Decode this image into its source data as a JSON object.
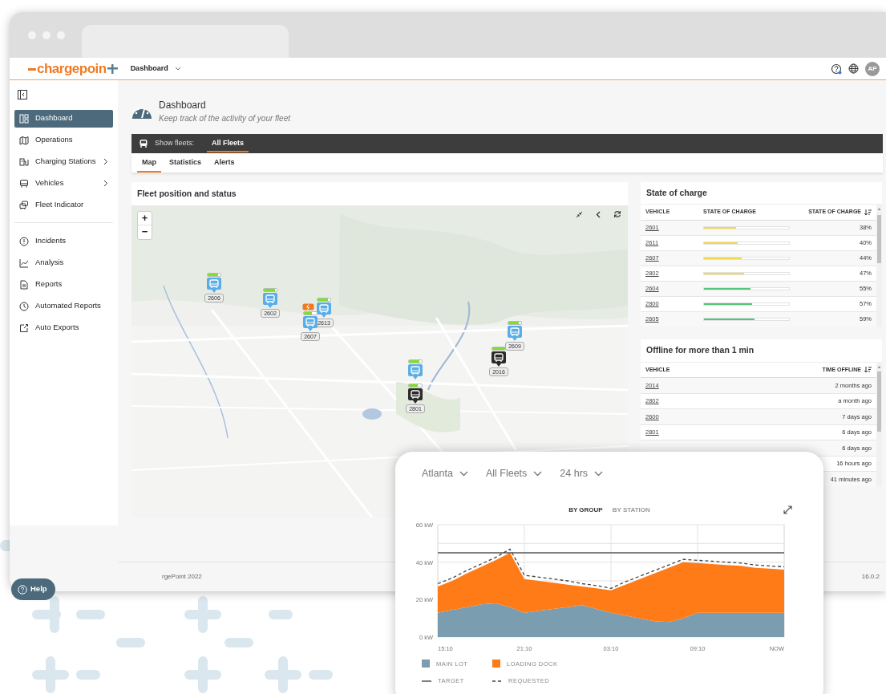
{
  "header": {
    "logo": "chargepoin",
    "menu": "Dashboard",
    "avatar": "AP"
  },
  "sidebar": {
    "groups": [
      [
        {
          "label": "Dashboard",
          "kind": "dashboard",
          "selected": true,
          "expandable": false
        },
        {
          "label": "Operations",
          "kind": "map",
          "selected": false,
          "expandable": false
        },
        {
          "label": "Charging Stations",
          "kind": "station",
          "selected": false,
          "expandable": true
        },
        {
          "label": "Vehicles",
          "kind": "bus",
          "selected": false,
          "expandable": true
        },
        {
          "label": "Fleet Indicator",
          "kind": "fleet",
          "selected": false,
          "expandable": false
        }
      ],
      [
        {
          "label": "Incidents",
          "kind": "alert",
          "selected": false,
          "expandable": false
        },
        {
          "label": "Analysis",
          "kind": "chart",
          "selected": false,
          "expandable": false
        },
        {
          "label": "Reports",
          "kind": "document",
          "selected": false,
          "expandable": false
        },
        {
          "label": "Automated Reports",
          "kind": "clock",
          "selected": false,
          "expandable": false
        },
        {
          "label": "Auto Exports",
          "kind": "export",
          "selected": false,
          "expandable": false
        }
      ]
    ]
  },
  "page": {
    "title": "Dashboard",
    "subtitle": "Keep track of the activity of your fleet"
  },
  "fleet_bar": {
    "label": "Show fleets:",
    "fleets": [
      {
        "label": "All Fleets",
        "selected": true
      }
    ]
  },
  "tabs": [
    {
      "label": "Map",
      "selected": true
    },
    {
      "label": "Statistics",
      "selected": false
    },
    {
      "label": "Alerts",
      "selected": false
    }
  ],
  "map_card": {
    "title": "Fleet position and status",
    "zoom_in": "+",
    "zoom_out": "−",
    "markers": [
      {
        "label": "2606",
        "kind": "online",
        "level": 0.8,
        "charging": false
      },
      {
        "label": "2602",
        "kind": "online",
        "level": 0.9,
        "charging": false
      },
      {
        "label": "2613",
        "kind": "online",
        "level": 0.8,
        "charging": false
      },
      {
        "label": "2607",
        "kind": "online",
        "level": 0.6,
        "charging": true
      },
      {
        "label": "2609",
        "kind": "online",
        "level": 0.8,
        "charging": false
      },
      {
        "label": "2016",
        "kind": "offline",
        "level": 1.0,
        "charging": false
      },
      {
        "kind": "online",
        "level": 0.8,
        "charging": false
      },
      {
        "label": "2801",
        "kind": "offline",
        "level": 0.7,
        "charging": false
      }
    ]
  },
  "state_of_charge": {
    "title": "State of charge",
    "columns": [
      "VEHICLE",
      "STATE OF CHARGE",
      "STATE OF CHARGE"
    ],
    "rows": [
      {
        "vehicle": "2601",
        "level": 0.38,
        "color": "#f2d94e",
        "percent": "38%"
      },
      {
        "vehicle": "2611",
        "level": 0.4,
        "color": "#f2d94e",
        "percent": "40%"
      },
      {
        "vehicle": "2607",
        "level": 0.44,
        "color": "#f2d94e",
        "percent": "44%"
      },
      {
        "vehicle": "2802",
        "level": 0.47,
        "color": "#f2d94e",
        "percent": "47%"
      },
      {
        "vehicle": "2604",
        "level": 0.55,
        "color": "#55c57a",
        "percent": "55%"
      },
      {
        "vehicle": "2800",
        "level": 0.57,
        "color": "#55c57a",
        "percent": "57%"
      },
      {
        "vehicle": "2605",
        "level": 0.59,
        "color": "#55c57a",
        "percent": "59%"
      }
    ]
  },
  "offline": {
    "title": "Offline for more than 1 min",
    "columns": [
      "VEHICLE",
      "TIME OFFLINE"
    ],
    "rows": [
      {
        "vehicle": "2014",
        "time": "2 months ago"
      },
      {
        "vehicle": "2802",
        "time": "a month ago"
      },
      {
        "vehicle": "2600",
        "time": "7 days ago"
      },
      {
        "vehicle": "2801",
        "time": "6 days ago"
      },
      {
        "time": "6 days ago"
      },
      {
        "time": "16 hours ago"
      },
      {
        "time": "41 minutes ago"
      }
    ]
  },
  "footer": {
    "copyright": "rgePoint 2022",
    "version": "16.0.2"
  },
  "help_button": "Help",
  "energy_card": {
    "filters": [
      "Atlanta",
      "All Fleets",
      "24 hrs"
    ],
    "views": [
      {
        "label": "BY GROUP",
        "selected": true
      },
      {
        "label": "BY STATION",
        "selected": false
      }
    ],
    "chart_data": {
      "type": "area",
      "stacked": true,
      "grid": true,
      "categories": [
        "15:10",
        null,
        null,
        null,
        null,
        null,
        "21:10",
        null,
        null,
        null,
        null,
        null,
        "03:10",
        null,
        null,
        null,
        null,
        null,
        "09:10",
        null,
        null,
        null,
        null,
        null,
        "NOW"
      ],
      "yticks": [
        {
          "value": 0,
          "label": "0 kW"
        },
        {
          "value": 20,
          "label": "20 kW"
        },
        {
          "value": 40,
          "label": "40 kW"
        },
        {
          "value": 60,
          "label": "60 kW"
        }
      ],
      "ylim": [
        0,
        60
      ],
      "series": [
        {
          "name": "MAIN LOT",
          "color": "#7a9db0",
          "values": [
            13,
            14.5,
            16,
            17.5,
            18,
            16,
            13,
            14,
            15,
            16,
            17,
            15,
            13,
            11.5,
            10,
            8.5,
            8,
            10,
            13,
            13,
            13,
            13,
            13,
            13,
            13
          ]
        },
        {
          "name": "LOADING DOCK",
          "color": "#ff7b17",
          "values": [
            14,
            15.5,
            18,
            20,
            23,
            29,
            18,
            16,
            14,
            12,
            10,
            11,
            12,
            16.5,
            21,
            25.5,
            29,
            30,
            26.5,
            26,
            25.5,
            25,
            24,
            23.5,
            23
          ]
        },
        {
          "name": "TARGET",
          "type": "line",
          "color": "#555555",
          "values": [
            45,
            45,
            45,
            45,
            45,
            45,
            45,
            45,
            45,
            45,
            45,
            45,
            45,
            45,
            45,
            45,
            45,
            45,
            45,
            45,
            45,
            45,
            45,
            45,
            45
          ]
        },
        {
          "name": "REQUESTED",
          "type": "line",
          "line_style": "dashed",
          "color": "#444444",
          "values": [
            28.5,
            31.5,
            35.5,
            39,
            42.5,
            47,
            33,
            32,
            31,
            30,
            28.5,
            27.5,
            26,
            29.5,
            32.5,
            35.5,
            38.5,
            41.5,
            41,
            40.5,
            40,
            39.5,
            38.5,
            38,
            37.5
          ]
        }
      ]
    }
  }
}
